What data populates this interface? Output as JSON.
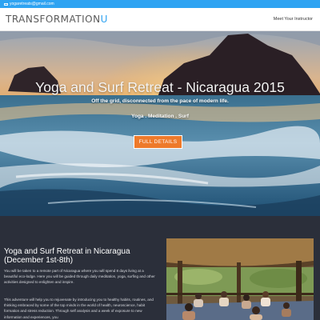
{
  "topbar": {
    "email": "yogaretreats@gmail.com"
  },
  "header": {
    "logo_main": "TRANSFORMATION",
    "logo_accent": "U",
    "nav_link": "Meet Your Instructor"
  },
  "hero": {
    "title": "Yoga and Surf Retreat - Nicaragua 2015",
    "subtitle": "Off the grid, disconnected from the pace of modern life.",
    "tags": "Yoga . Meditation . Surf",
    "cta_label": "FULL DETAILS"
  },
  "section": {
    "title": "Yoga and Surf Retreat in Nicaragua (December 1st-8th)",
    "paragraph1": "You will be taken to a remote part of Nicaragua where you will spend 8 days living at a beautiful eco-lodge. Here you will be guided through daily meditation, yoga, surfing and other activities designed to enlighten and inspire.",
    "paragraph2": "This adventure will help you to rejuvenate by introducing you to healthy habits, routines, and thinking embraced by some of the top minds in the world of health, neuroscience, habit formation and stress reduction. Through self analysis and a week of exposure to new information and experiences, you"
  },
  "colors": {
    "accent": "#2ea3f2",
    "cta": "#ee7a2b",
    "section_bg": "#2b2f3a"
  }
}
